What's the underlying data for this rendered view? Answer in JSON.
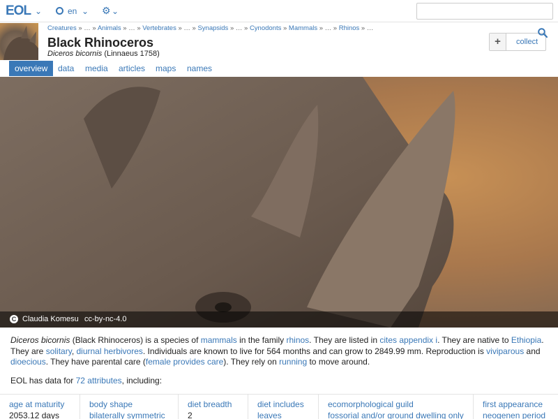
{
  "topbar": {
    "logo": "EOL",
    "language": "en"
  },
  "header": {
    "breadcrumb": [
      {
        "label": "Creatures",
        "link": true
      },
      {
        "label": "…",
        "link": false
      },
      {
        "label": "Animals",
        "link": true
      },
      {
        "label": "…",
        "link": false
      },
      {
        "label": "Vertebrates",
        "link": true
      },
      {
        "label": "…",
        "link": false
      },
      {
        "label": "Synapsids",
        "link": true
      },
      {
        "label": "…",
        "link": false
      },
      {
        "label": "Cynodonts",
        "link": true
      },
      {
        "label": "Mammals",
        "link": true
      },
      {
        "label": "…",
        "link": false
      },
      {
        "label": "Rhinos",
        "link": true
      },
      {
        "label": "…",
        "link": false
      }
    ],
    "title": "Black Rhinoceros",
    "scientific_name": "Diceros bicornis",
    "authority": "(Linnaeus 1758)",
    "collect_plus": "+",
    "collect_label": "collect"
  },
  "tabs": [
    "overview",
    "data",
    "media",
    "articles",
    "maps",
    "names"
  ],
  "active_tab": "overview",
  "hero": {
    "author": "Claudia Komesu",
    "license": "cc-by-nc-4.0",
    "cc_glyph": "C"
  },
  "summary": {
    "name_italic": "Diceros bicornis",
    "t1": " (Black Rhinoceros) is a species of ",
    "l_mammals": "mammals",
    "t2": " in the family ",
    "l_rhinos": "rhinos",
    "t3": ". They are listed in ",
    "l_cites": "cites appendix i",
    "t4": ". They are native to ",
    "l_ethiopia": "Ethiopia",
    "t5": ". They are ",
    "l_solitary": "solitary",
    "t6": ", ",
    "l_diurnal": "diurnal herbivores",
    "t7": ". Individuals are known to live for 564 months and can grow to 2849.99 mm. Reproduction is ",
    "l_viviparous": "viviparous",
    "t8": " and ",
    "l_dioecious": "dioecious",
    "t9": ". They have parental care (",
    "l_female": "female provides care",
    "t10": "). They rely on ",
    "l_running": "running",
    "t11": " to move around."
  },
  "data_count": {
    "prefix": "EOL has data for ",
    "link": "72 attributes",
    "suffix": ", including:"
  },
  "attributes": [
    {
      "name": "age at maturity",
      "value": "2053.12 days",
      "value_is_link": false
    },
    {
      "name": "body shape",
      "value": "bilaterally symmetric",
      "value_is_link": true
    },
    {
      "name": "diet breadth",
      "value": "2",
      "value_is_link": false
    },
    {
      "name": "diet includes",
      "value": "leaves",
      "value_is_link": true
    },
    {
      "name": "ecomorphological guild",
      "value": "fossorial and/or ground dwelling only",
      "value_is_link": true
    },
    {
      "name": "first appearance",
      "value": "neogenen period",
      "value_is_link": true
    }
  ],
  "colors": {
    "accent": "#3a78b7",
    "text": "#222222"
  }
}
